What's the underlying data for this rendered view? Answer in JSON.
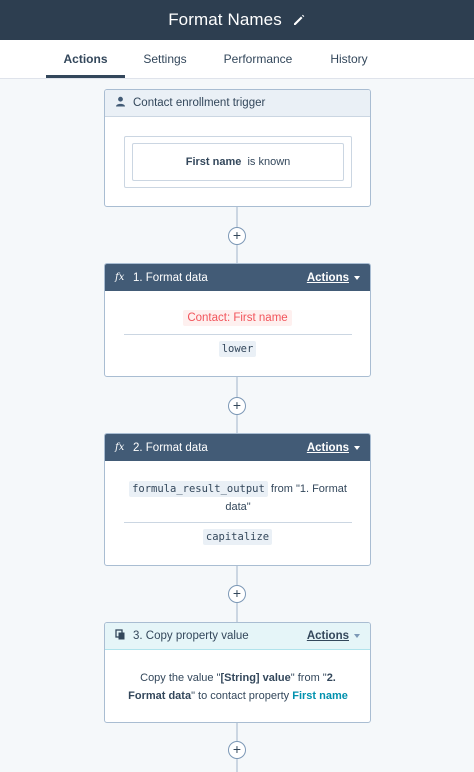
{
  "header": {
    "title": "Format Names",
    "edit_icon": "pencil-icon"
  },
  "tabs": [
    {
      "label": "Actions",
      "active": true
    },
    {
      "label": "Settings",
      "active": false
    },
    {
      "label": "Performance",
      "active": false
    },
    {
      "label": "History",
      "active": false
    }
  ],
  "trigger": {
    "title": "Contact enrollment trigger",
    "icon": "person-icon",
    "condition_property": "First name",
    "condition_text": "is known"
  },
  "steps": [
    {
      "title": "1. Format data",
      "icon": "fx-icon",
      "actions_label": "Actions",
      "input": "Contact: First name",
      "operation": "lower"
    },
    {
      "title": "2. Format data",
      "icon": "fx-icon",
      "actions_label": "Actions",
      "input_token": "formula_result_output",
      "input_suffix": " from \"1. Format data\"",
      "operation": "capitalize"
    },
    {
      "title": "3. Copy property value",
      "icon": "copy-icon",
      "actions_label": "Actions",
      "desc_prefix": "Copy the value \"",
      "desc_value": "[String] value",
      "desc_mid": "\" from \"",
      "desc_source": "2. Format data",
      "desc_mid2": "\" to contact property ",
      "desc_target": "First name"
    }
  ],
  "add_button_label": "+",
  "colors": {
    "topbar": "#2d3e50",
    "dark_header": "#425b76",
    "accent_teal": "#0091ae",
    "token_red": "#f2545b"
  }
}
